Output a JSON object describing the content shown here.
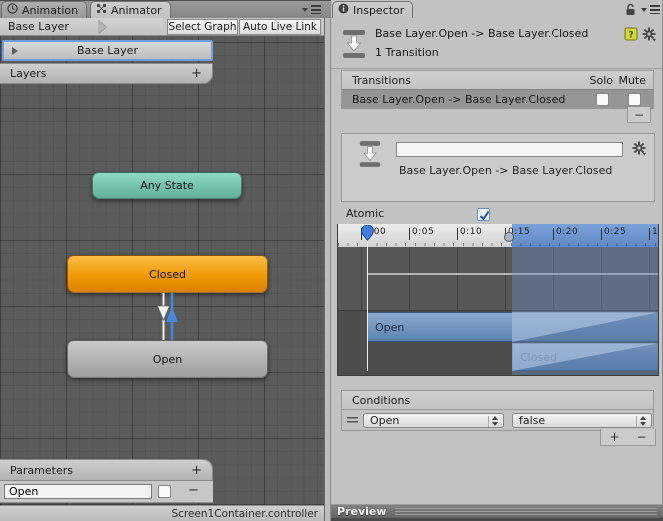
{
  "animator": {
    "tabs": [
      {
        "label": "Animation"
      },
      {
        "label": "Animator"
      }
    ],
    "toolbar": {
      "breadcrumb": "Base Layer",
      "select_graph": "Select Graph",
      "auto_live_link": "Auto Live Link"
    },
    "layers_panel": {
      "selected_layer": "Base Layer",
      "header": "Layers",
      "add_button": "+"
    },
    "graph": {
      "nodes": [
        {
          "label": "Any State"
        },
        {
          "label": "Closed"
        },
        {
          "label": "Open"
        }
      ]
    },
    "parameters": {
      "header": "Parameters",
      "add_button": "+",
      "rows": [
        {
          "name": "Open",
          "checked": false,
          "remove_button": "−"
        }
      ]
    },
    "status_bar": "Screen1Container.controller"
  },
  "inspector": {
    "tab_label": "Inspector",
    "header": {
      "title": "Base Layer.Open -> Base Layer.Closed",
      "subtitle": "1 Transition"
    },
    "transitions": {
      "header": "Transitions",
      "solo_label": "Solo",
      "mute_label": "Mute",
      "rows": [
        {
          "label": "Base Layer.Open -> Base Layer.Closed",
          "solo": false,
          "mute": false
        }
      ],
      "remove_button": "−"
    },
    "transition_detail": {
      "name_value": "",
      "label": "Base Layer.Open -> Base Layer.Closed"
    },
    "atomic": {
      "label": "Atomic",
      "checked": true
    },
    "timeline": {
      "ticks": [
        "0:00",
        "0:05",
        "0:10",
        "0:15",
        "0:20",
        "0:25",
        "1"
      ],
      "clips": [
        {
          "label": "Open"
        },
        {
          "label": "Closed"
        }
      ]
    },
    "conditions": {
      "header": "Conditions",
      "rows": [
        {
          "parameter": "Open",
          "value": "false"
        }
      ],
      "add_button": "+",
      "remove_button": "−"
    },
    "preview": {
      "header": "Preview"
    }
  },
  "colors": {
    "node_any_state": "#6fc0aa",
    "node_closed_selected": "#f09a04",
    "node_open": "#aeaeae",
    "selection_outline": "#6f9fdd",
    "timeline_blue": "#6c94cf",
    "transition_arrow_blue": "#4a86dd",
    "panel_background": "#c2c2c2",
    "graph_background": "#5b5b5b"
  }
}
